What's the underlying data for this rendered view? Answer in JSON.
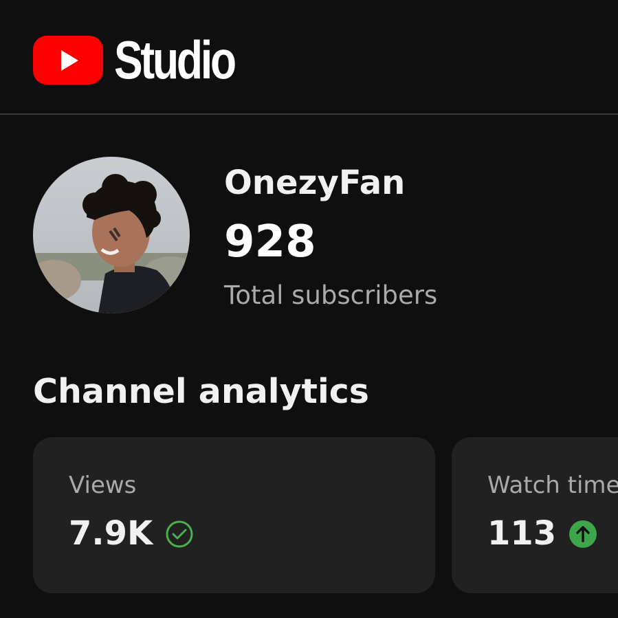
{
  "header": {
    "logo_icon": "youtube-play-icon",
    "logo_text": "Studio",
    "brand_color": "#ff0000"
  },
  "profile": {
    "avatar_icon": "channel-avatar",
    "channel_name": "OnezyFan",
    "subscriber_count": "928",
    "subscriber_label": "Total subscribers"
  },
  "analytics": {
    "title": "Channel analytics",
    "cards": [
      {
        "label": "Views",
        "value": "7.9K",
        "status_icon": "check-circle-icon",
        "status_color": "#4caf50"
      },
      {
        "label": "Watch time",
        "value": "113",
        "status_icon": "arrow-up-circle-icon",
        "status_color": "#3ea64a"
      }
    ]
  }
}
